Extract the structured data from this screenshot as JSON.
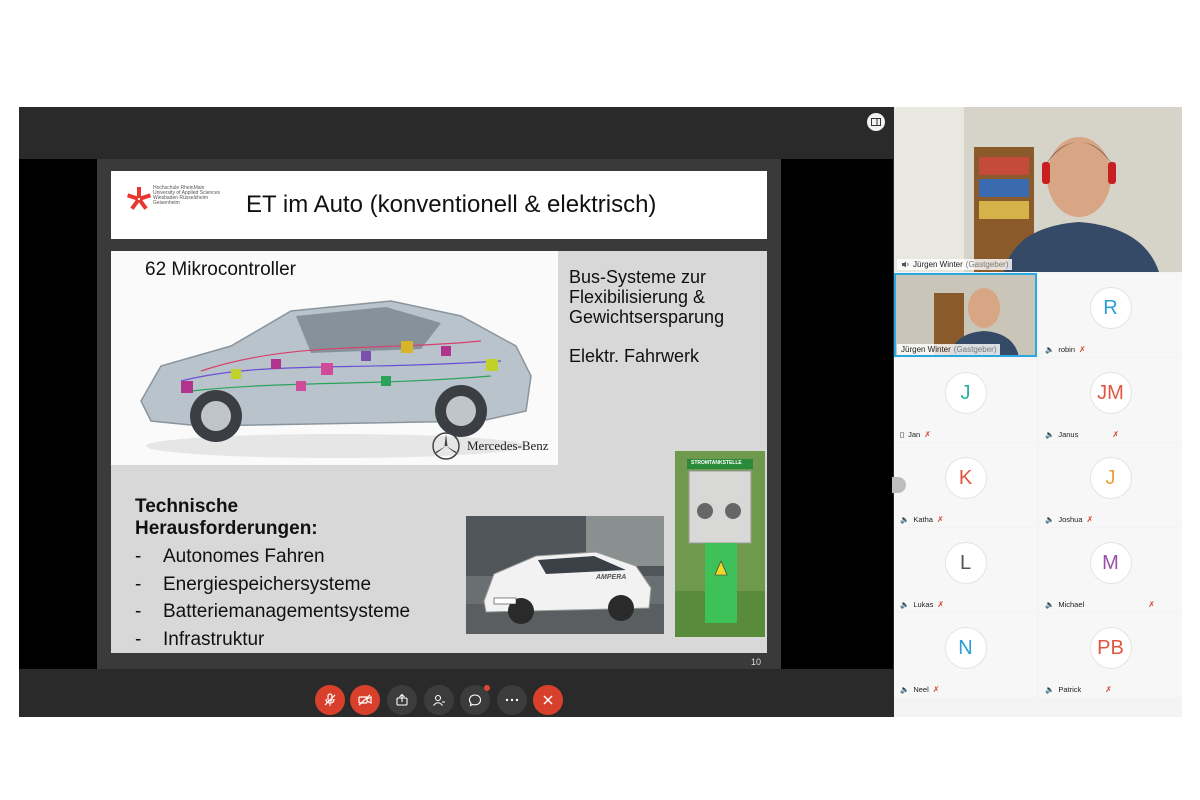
{
  "slide": {
    "logo_lines": [
      "Hochschule RheinMain",
      "University of Applied Sciences",
      "Wiesbaden Rüsselsheim Geisenheim"
    ],
    "title": "ET im Auto (konventionell & elektrisch)",
    "car_label": "62 Mikrocontroller",
    "brand": "Mercedes-Benz",
    "bus_lines": [
      "Bus-Systeme zur",
      "Flexibilisierung &",
      "Gewichtsersparung"
    ],
    "fahrwerk": "Elektr. Fahrwerk",
    "tech_title_lines": [
      "Technische",
      "Herausforderungen:"
    ],
    "tech_items": [
      "Autonomes Fahren",
      "Energiespeichersysteme",
      "Batteriemanagementsysteme",
      "Infrastruktur"
    ],
    "photo_station_sign": "STROMTANKSTELLE",
    "photo_car_text": "AMPERA",
    "page_number": "10"
  },
  "toolbar": {
    "buttons": [
      {
        "name": "mute-mic-button",
        "icon": "mic-off-icon",
        "style": "red"
      },
      {
        "name": "stop-video-button",
        "icon": "video-off-icon",
        "style": "red"
      },
      {
        "name": "share-button",
        "icon": "share-icon",
        "style": "dark"
      },
      {
        "name": "participants-button",
        "icon": "participants-icon",
        "style": "dark"
      },
      {
        "name": "chat-button",
        "icon": "chat-icon",
        "style": "dark"
      },
      {
        "name": "more-button",
        "icon": "more-icon",
        "style": "dark"
      },
      {
        "name": "leave-button",
        "icon": "close-icon",
        "style": "red"
      }
    ]
  },
  "host": {
    "name": "Jürgen Winter",
    "role": "(Gastgeber)"
  },
  "participants": [
    {
      "name": "Jürgen Winter",
      "role": "(Gastgeber)",
      "initials": "",
      "color": "#2aa9e0",
      "video": true
    },
    {
      "name": "robin",
      "initials": "R",
      "color": "#2a9fd6"
    },
    {
      "name": "Jan",
      "initials": "J",
      "color": "#2bb09a"
    },
    {
      "name": "Janus",
      "initials": "JM",
      "color": "#e2563f"
    },
    {
      "name": "Katha",
      "initials": "K",
      "color": "#e2563f"
    },
    {
      "name": "Joshua",
      "initials": "J",
      "color": "#e8a33b"
    },
    {
      "name": "Lukas",
      "initials": "L",
      "color": "#555555"
    },
    {
      "name": "Michael",
      "initials": "M",
      "color": "#9b4fa8"
    },
    {
      "name": "Neel",
      "initials": "N",
      "color": "#2a9fd6"
    },
    {
      "name": "Patrick",
      "initials": "PB",
      "color": "#e2563f"
    }
  ]
}
